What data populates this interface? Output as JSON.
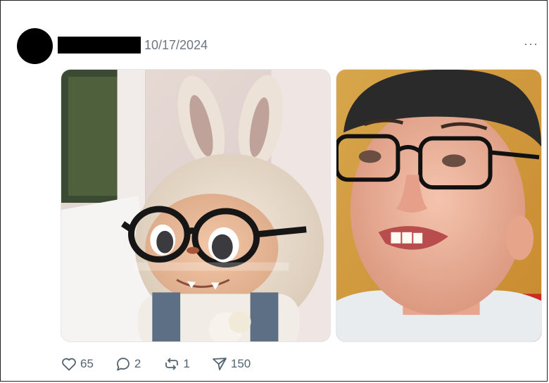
{
  "post": {
    "date": "10/17/2024",
    "more_label": "···"
  },
  "media": {
    "left_alt": "Plush doll wearing glasses",
    "right_alt": "Person wearing glasses and beanie"
  },
  "actions": {
    "likes": "65",
    "replies": "2",
    "reposts": "1",
    "views": "150"
  },
  "colors": {
    "text_muted": "#536471",
    "redaction": "#000000"
  }
}
